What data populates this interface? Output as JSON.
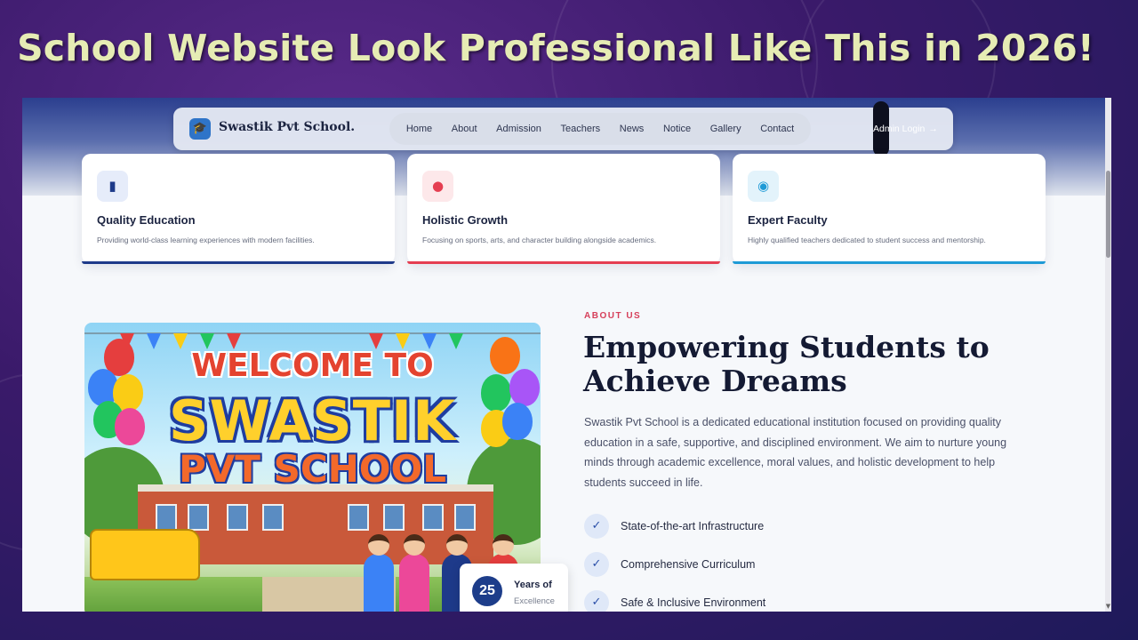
{
  "headline": "School Website Look Professional Like This in 2026!",
  "nav": {
    "logo_text": "Swastik Pvt School.",
    "links": [
      "Home",
      "About",
      "Admission",
      "Teachers",
      "News",
      "Notice",
      "Gallery",
      "Contact"
    ],
    "admin_label": "Admin Login"
  },
  "features": [
    {
      "title": "Quality Education",
      "desc": "Providing world-class learning experiences with modern facilities.",
      "color": "#1e3a8a",
      "icon": "book-icon"
    },
    {
      "title": "Holistic Growth",
      "desc": "Focusing on sports, arts, and character building alongside academics.",
      "color": "#e53e51",
      "icon": "person-icon"
    },
    {
      "title": "Expert Faculty",
      "desc": "Highly qualified teachers dedicated to student success and mentorship.",
      "color": "#1e9ad6",
      "icon": "users-icon"
    }
  ],
  "welcome_image": {
    "line1": "WELCOME TO",
    "line2": "SWASTIK",
    "line3": "PVT SCHOOL"
  },
  "years": {
    "number": "25",
    "title": "Years of",
    "sub": "Excellence"
  },
  "about": {
    "label": "ABOUT US",
    "heading": "Empowering Students to Achieve Dreams",
    "paragraph": "Swastik Pvt School is a dedicated educational institution focused on providing quality education in a safe, supportive, and disciplined environment. We aim to nurture young minds through academic excellence, moral values, and holistic development to help students succeed in life.",
    "points": [
      "State-of-the-art Infrastructure",
      "Comprehensive Curriculum",
      "Safe & Inclusive Environment"
    ]
  }
}
